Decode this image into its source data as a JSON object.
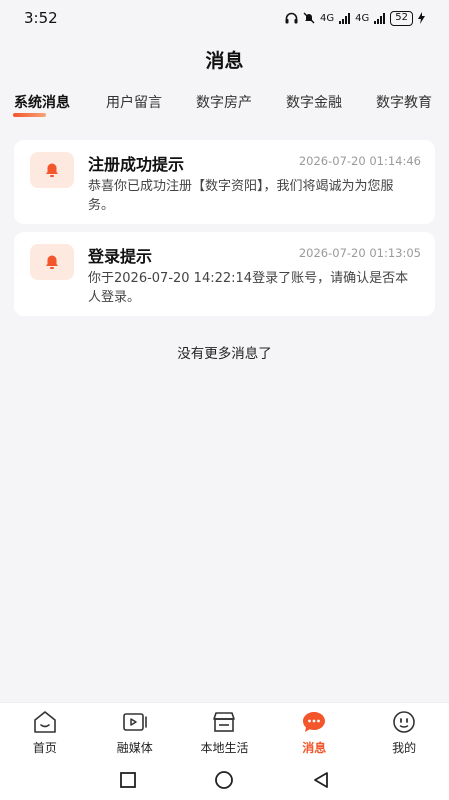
{
  "status_bar": {
    "time": "3:52",
    "network1": "4G",
    "network2": "4G",
    "battery": "52"
  },
  "header": {
    "title": "消息"
  },
  "tabs": [
    {
      "label": "系统消息",
      "active": true
    },
    {
      "label": "用户留言"
    },
    {
      "label": "数字房产"
    },
    {
      "label": "数字金融"
    },
    {
      "label": "数字教育"
    }
  ],
  "messages": [
    {
      "title": "注册成功提示",
      "time": "2026-07-20 01:14:46",
      "body": "恭喜你已成功注册【数字资阳】，我们将竭诚为为您服务。"
    },
    {
      "title": "登录提示",
      "time": "2026-07-20 01:13:05",
      "body": "你于2026-07-20 14:22:14登录了账号，请确认是否本人登录。"
    }
  ],
  "footer_note": "没有更多消息了",
  "bottom_nav": [
    {
      "label": "首页",
      "icon": "home-icon"
    },
    {
      "label": "融媒体",
      "icon": "video-icon"
    },
    {
      "label": "本地生活",
      "icon": "store-icon"
    },
    {
      "label": "消息",
      "icon": "message-icon",
      "active": true
    },
    {
      "label": "我的",
      "icon": "face-icon"
    }
  ],
  "colors": {
    "accent": "#f2562a",
    "icon_bg": "#fde9e0",
    "background": "#f5f5f7"
  }
}
